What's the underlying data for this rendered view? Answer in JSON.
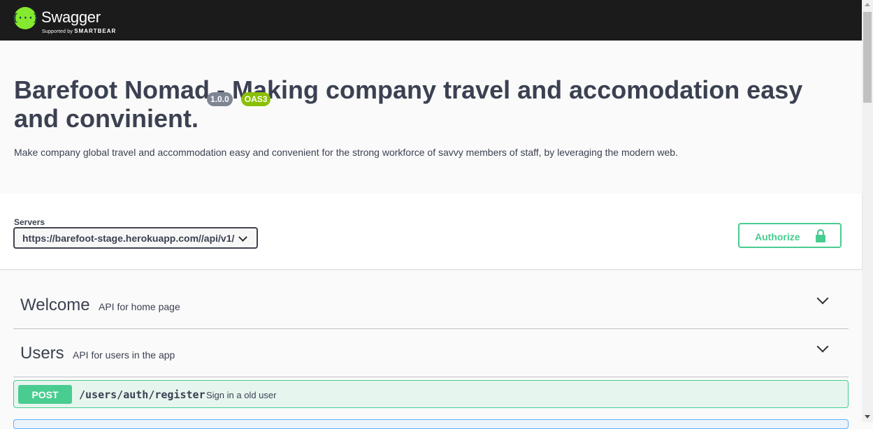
{
  "topbar": {
    "logo_text": "Swagger",
    "logo_glyph": "{···}",
    "supported_by": "Supported by",
    "smartbear": "SMARTBEAR",
    "logo_color": "#85ea2d"
  },
  "info": {
    "title": "Barefoot Nomad - Making company travel and accomodation easy and convinient.",
    "version": "1.0.0",
    "oas_badge": "OAS3",
    "description": "Make company global travel and accommodation easy and convenient for the strong workforce of savvy members of staff, by leveraging the modern web."
  },
  "servers": {
    "label": "Servers",
    "selected": "https://barefoot-stage.herokuapp.com//api/v1/"
  },
  "authorize": {
    "label": "Authorize",
    "icon": "lock-icon",
    "color": "#49cc90"
  },
  "tags": [
    {
      "name": "Welcome",
      "description": "API for home page"
    },
    {
      "name": "Users",
      "description": "API for users in the app"
    }
  ],
  "operations": [
    {
      "method": "POST",
      "path": "/users/auth/register",
      "summary": "Sign in a old user",
      "color": "#49cc90"
    }
  ]
}
